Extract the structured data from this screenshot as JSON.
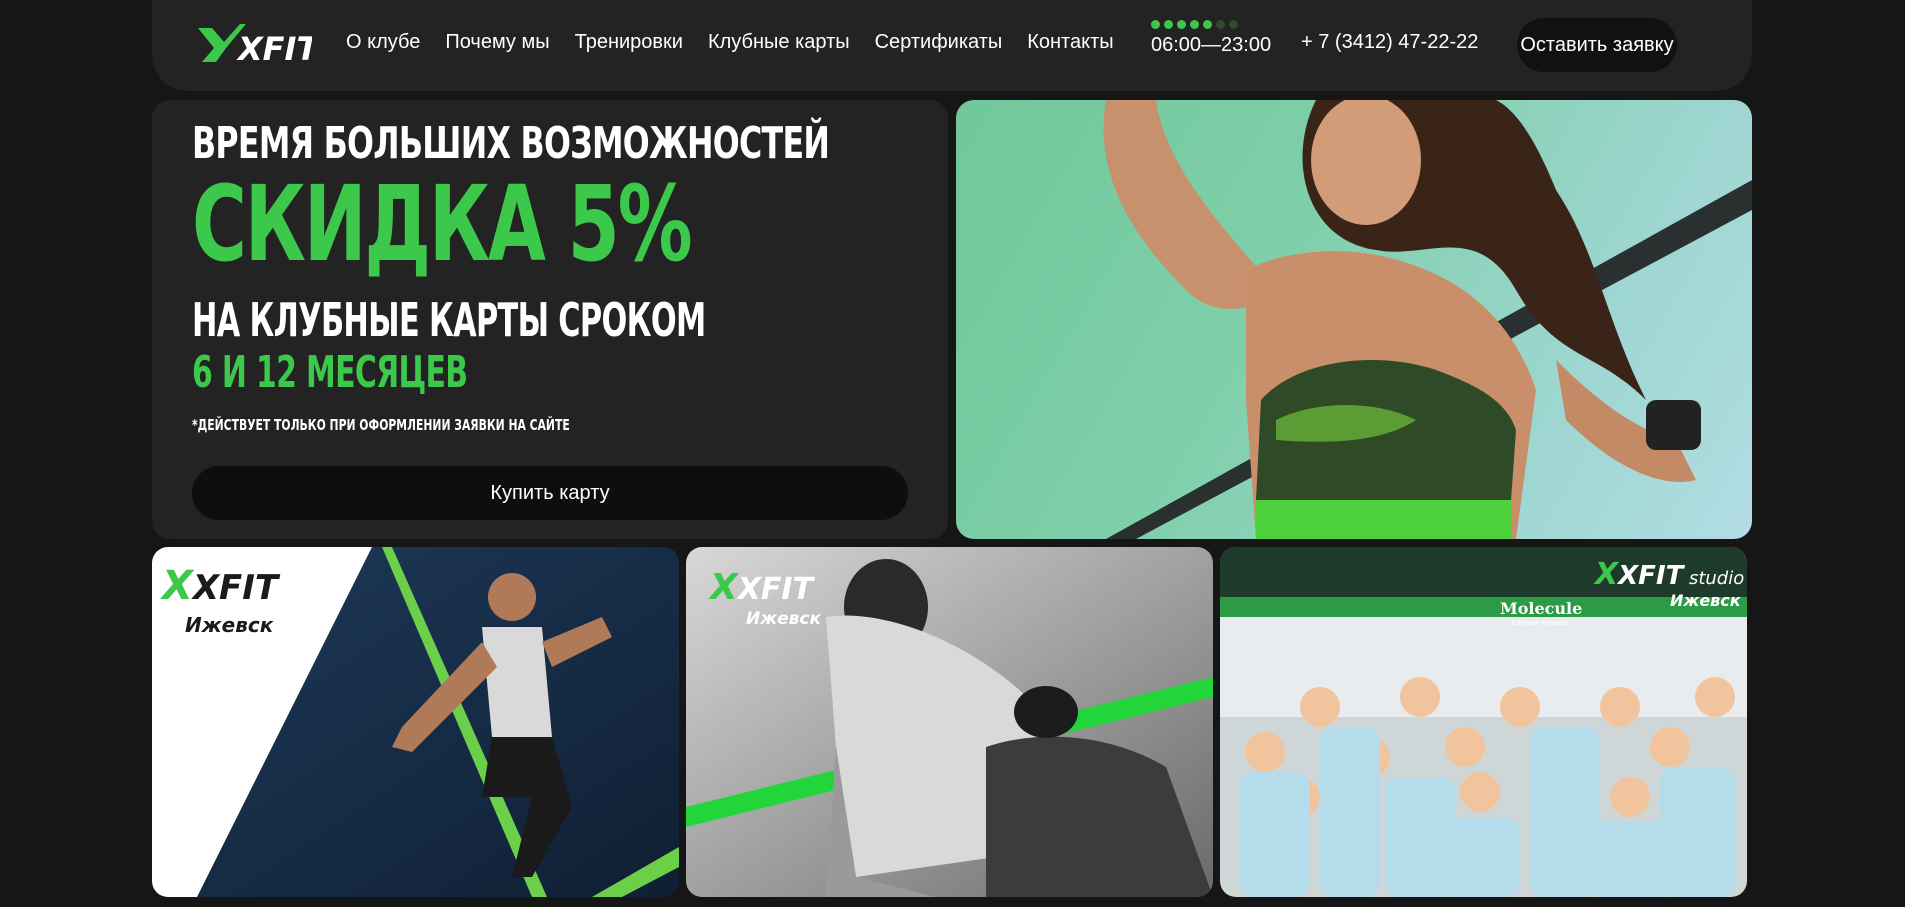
{
  "brand": {
    "logo_text": "XFIT",
    "accent_color": "#3cc84a",
    "bg_color": "#161616",
    "panel_color": "#232323"
  },
  "header": {
    "nav": [
      "О клубе",
      "Почему мы",
      "Тренировки",
      "Клубные карты",
      "Сертификаты",
      "Контакты"
    ],
    "hours": "06:00—23:00",
    "phone": "+ 7 (3412) 47-22-22",
    "cta_label": "Оставить заявку"
  },
  "promo": {
    "line1": "Время больших возможностей",
    "line2": "Скидка 5%",
    "line3": "На клубные карты сроком",
    "line4": "6 и 12 месяцев",
    "note": "*Действует только при оформлении заявки на сайте",
    "button_label": "Купить карту"
  },
  "cards": [
    {
      "logo": "XFIT",
      "city": "Ижевск",
      "icon": "runner-photo"
    },
    {
      "logo": "XFIT",
      "city": "Ижевск",
      "icon": "massage-photo"
    },
    {
      "logo": "XFIT",
      "studio": "studio",
      "city": "Ижевск",
      "partner": "Molecule",
      "partner_sub": "Студия танцев",
      "icon": "kids-group-photo"
    }
  ]
}
